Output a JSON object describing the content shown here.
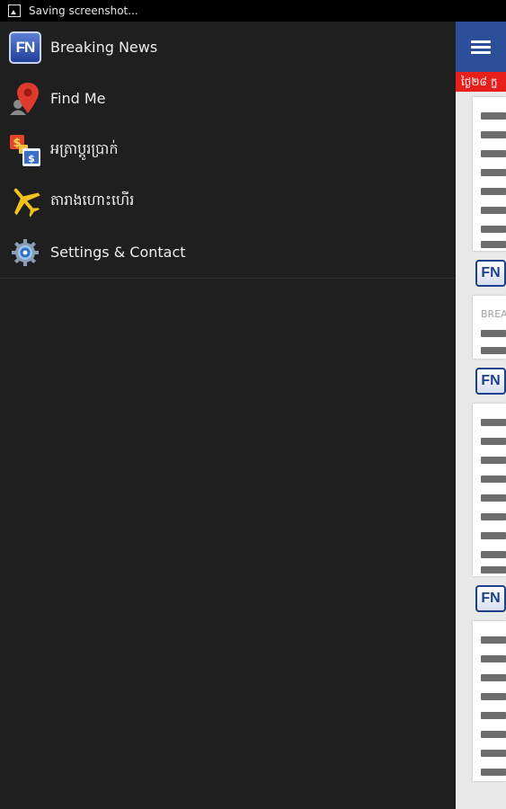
{
  "status_bar": {
    "text": "Saving screenshot..."
  },
  "drawer": {
    "items": [
      {
        "label": "Breaking News",
        "icon": "fn-logo-icon"
      },
      {
        "label": "Find Me",
        "icon": "map-pin-icon"
      },
      {
        "label": "អត្រាប្តូរប្រាក់",
        "icon": "currency-exchange-icon"
      },
      {
        "label": "តារាងហោះហើរ",
        "icon": "airplane-icon"
      },
      {
        "label": "Settings & Contact",
        "icon": "gear-icon"
      }
    ]
  },
  "content": {
    "ticker_text": "ថ្ងៃ២៨ ក្ន",
    "logo_text": "FN",
    "card_gray_text": "BREA",
    "colors": {
      "app_bar": "#2d4f99",
      "ticker": "#e8201c",
      "drawer_bg": "#1f1f1f"
    }
  }
}
